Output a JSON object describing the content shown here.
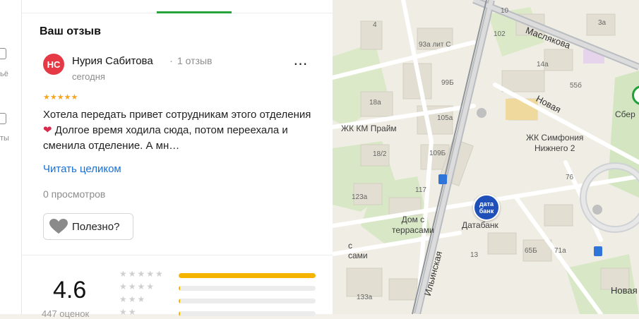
{
  "rail": {
    "frag1": "ьё",
    "frag2": "ты"
  },
  "review_section": {
    "title": "Ваш отзыв"
  },
  "review": {
    "avatar_initials": "НС",
    "author": "Нурия Сабитова",
    "dot": "·",
    "author_reviews": "1 отзыв",
    "date": "сегодня",
    "more_icon": "⋯",
    "stars": "★★★★★",
    "rating": 5,
    "text_part1": "Хотела передать привет сотрудникам этого отделения",
    "heart": "❤",
    "text_part2": "Долгое время ходила сюда, потом переехала и сменила отделение. А мн…",
    "read_more": "Читать целиком",
    "views": "0 просмотров",
    "useful_label": "Полезно?"
  },
  "summary": {
    "average": "4.6",
    "ratings_count": "447 оценок",
    "bars": [
      {
        "stars": "★★★★★",
        "fraction": 0.998
      },
      {
        "stars": "★★★★",
        "fraction": 0.01
      },
      {
        "stars": "★★★",
        "fraction": 0.01
      },
      {
        "stars": "★★",
        "fraction": 0.01
      }
    ]
  },
  "map": {
    "streets": {
      "maslyakova": "Маслякова",
      "novaya": "Новая",
      "novaya2": "Новая",
      "ilinskaya": "Ильинская"
    },
    "places": {
      "zhk_km": "ЖК КМ Прайм",
      "zhk_simf": "ЖК Симфония\nНижнего 2",
      "dom_terr": "Дом с\nтеррасами",
      "databank": "Датабанк",
      "sber": "Сбер",
      "cut": "с\nсами",
      "databank_pin": "дата\nбанк"
    },
    "houses": [
      "4",
      "93а лит С",
      "99Б",
      "105а",
      "109Б",
      "117",
      "123а",
      "18а",
      "18/2",
      "102",
      "10",
      "14а",
      "55б",
      "76",
      "65Б",
      "71а",
      "3а",
      "13",
      "133а"
    ],
    "colors": {
      "road": "#ffffff",
      "major": "#9aa0a6",
      "park": "#d8e8c6",
      "building": "#e2ded2",
      "accent": "#27a33b"
    }
  }
}
